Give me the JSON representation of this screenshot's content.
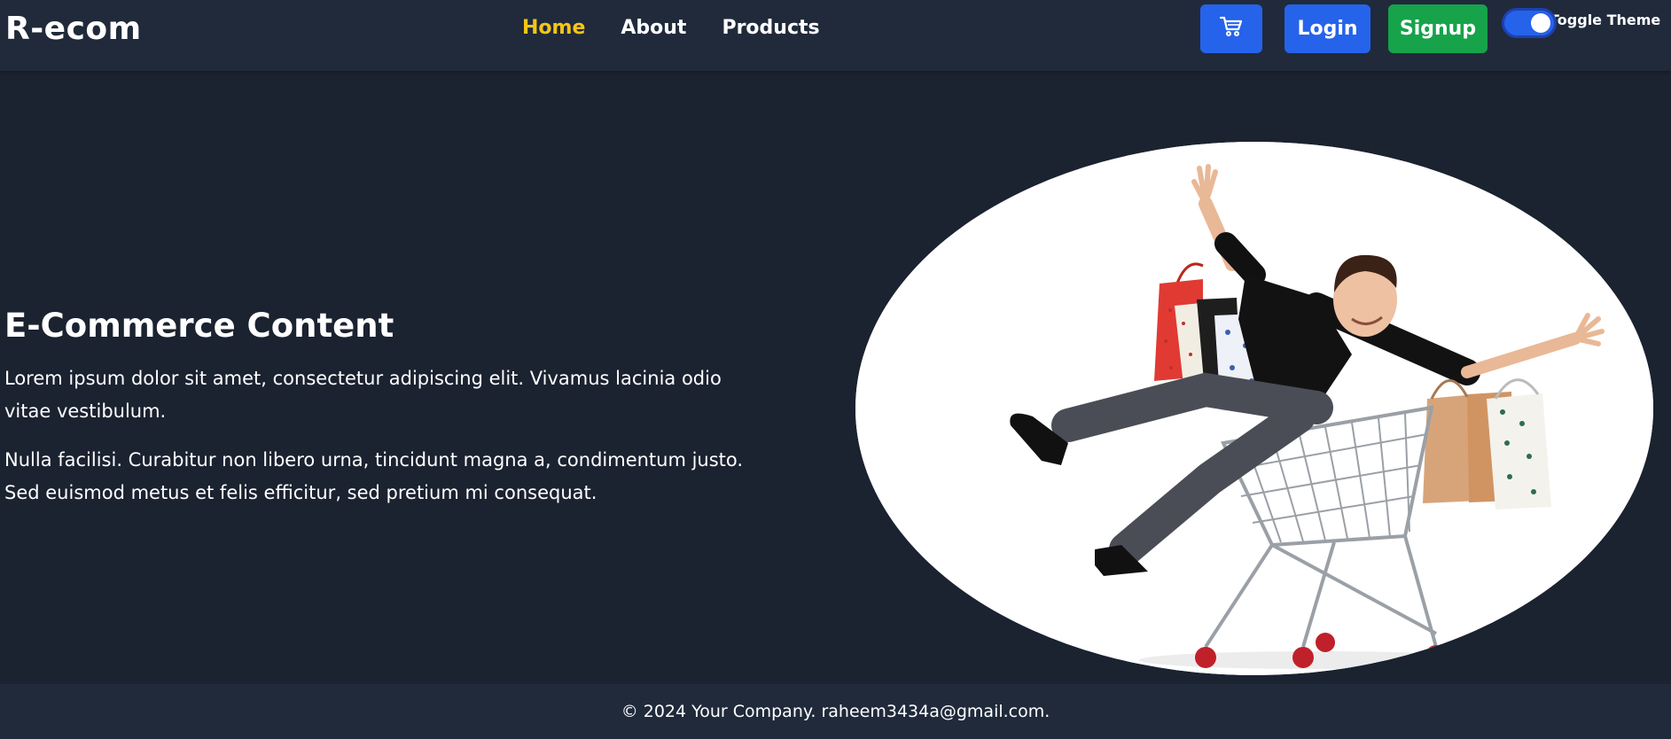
{
  "brand": "R-ecom",
  "nav": {
    "links": [
      {
        "label": "Home",
        "active": true
      },
      {
        "label": "About",
        "active": false
      },
      {
        "label": "Products",
        "active": false
      }
    ]
  },
  "header_actions": {
    "cart_icon": "shopping-cart-icon",
    "login_label": "Login",
    "signup_label": "Signup",
    "toggle_label": "Toggle Theme",
    "toggle_on": true
  },
  "hero": {
    "title": "E-Commerce Content",
    "paragraphs": [
      "Lorem ipsum dolor sit amet, consectetur adipiscing elit. Vivamus lacinia odio vitae vestibulum.",
      "Nulla facilisi. Curabitur non libero urna, tincidunt magna a, condimentum justo. Sed euismod metus et felis efficitur, sed pretium mi consequat."
    ],
    "image_subject": "man-in-shopping-cart-with-bags"
  },
  "footer": {
    "text": "© 2024 Your Company. raheem3434a@gmail.com."
  },
  "colors": {
    "background": "#1b2230",
    "navbar": "#202a3b",
    "active_link": "#f5c518",
    "primary_button": "#2563eb",
    "signup_button": "#16a34a"
  }
}
